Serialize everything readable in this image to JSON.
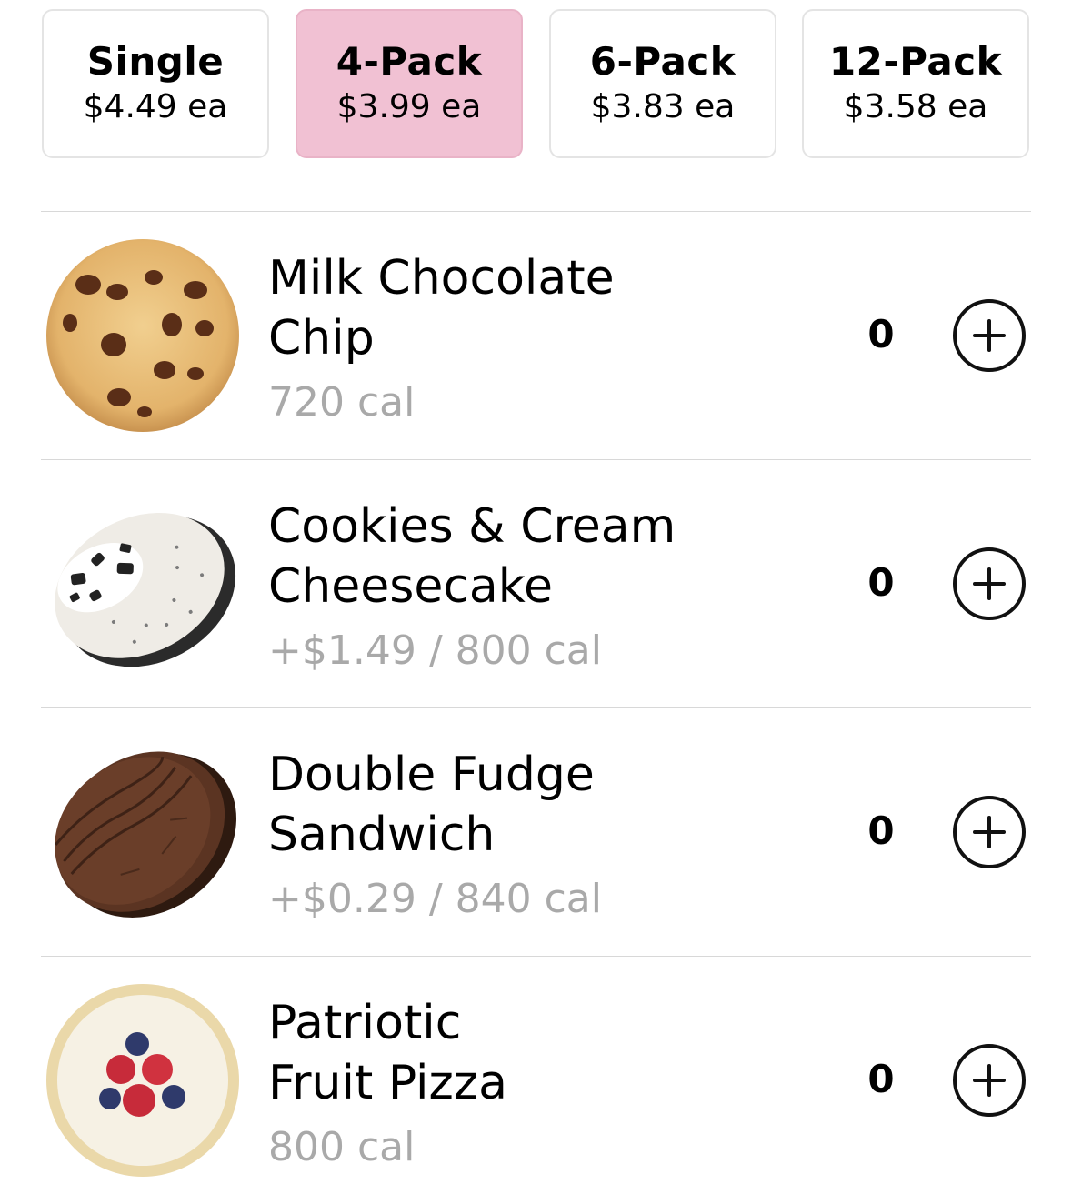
{
  "packs": [
    {
      "name": "Single",
      "price": "$4.49 ea",
      "selected": false
    },
    {
      "name": "4-Pack",
      "price": "$3.99 ea",
      "selected": true
    },
    {
      "name": "6-Pack",
      "price": "$3.83 ea",
      "selected": false
    },
    {
      "name": "12-Pack",
      "price": "$3.58 ea",
      "selected": false
    }
  ],
  "items": [
    {
      "name_line1": "Milk Chocolate",
      "name_line2": "Chip",
      "meta": "720 cal",
      "qty": "0",
      "image": "milk-chocolate-chip-cookie"
    },
    {
      "name_line1": "Cookies & Cream",
      "name_line2": "Cheesecake",
      "meta": "+$1.49 / 800 cal",
      "qty": "0",
      "image": "cookies-and-cream-cheesecake-cookie"
    },
    {
      "name_line1": "Double Fudge",
      "name_line2": "Sandwich",
      "meta": "+$0.29 / 840 cal",
      "qty": "0",
      "image": "double-fudge-sandwich-cookie"
    },
    {
      "name_line1": "Patriotic",
      "name_line2": "Fruit Pizza",
      "meta": "800 cal",
      "qty": "0",
      "image": "patriotic-fruit-pizza-cookie"
    }
  ],
  "colors": {
    "selected_pack": "#f1c1d3",
    "meta_text": "#a9a9a9",
    "divider": "#d8d8d8"
  },
  "icons": {
    "add": "plus-circle-icon"
  }
}
